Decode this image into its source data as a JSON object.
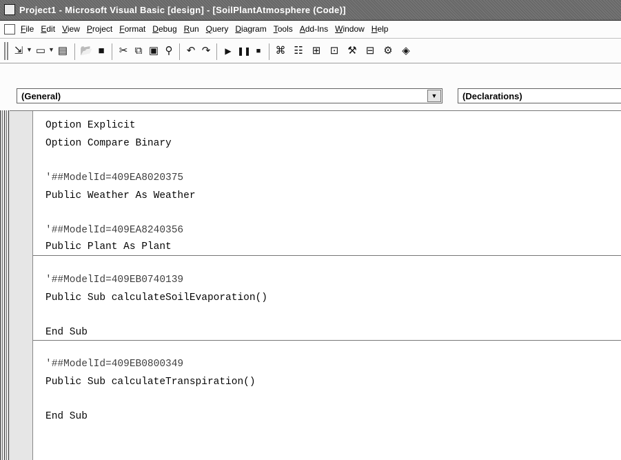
{
  "window": {
    "title": "Project1 - Microsoft Visual Basic [design] - [SoilPlantAtmosphere (Code)]"
  },
  "menu": {
    "items": [
      "File",
      "Edit",
      "View",
      "Project",
      "Format",
      "Debug",
      "Run",
      "Query",
      "Diagram",
      "Tools",
      "Add-Ins",
      "Window",
      "Help"
    ]
  },
  "toolbar": {
    "icons": [
      "add-project-icon",
      "add-form-icon",
      "menu-editor-icon",
      "open-icon",
      "save-icon",
      "cut-icon",
      "copy-icon",
      "paste-icon",
      "find-icon",
      "undo-icon",
      "redo-icon",
      "run-icon",
      "pause-icon",
      "stop-icon",
      "project-explorer-icon",
      "properties-icon",
      "form-layout-icon",
      "object-browser-icon",
      "toolbox-icon",
      "data-view-icon",
      "visual-component-manager-icon",
      "tool-icon"
    ]
  },
  "editor": {
    "object_combo": "(General)",
    "procedure_combo": "(Declarations)",
    "lines": [
      "Option Explicit",
      "Option Compare Binary",
      "'##ModelId=409EA8020375",
      "Public Weather As Weather",
      "'##ModelId=409EA8240356",
      "Public Plant As Plant",
      "'##ModelId=409EB0740139",
      "Public Sub calculateSoilEvaporation()",
      "End Sub",
      "'##ModelId=409EB0800349",
      "Public Sub calculateTranspiration()",
      "End Sub"
    ]
  }
}
